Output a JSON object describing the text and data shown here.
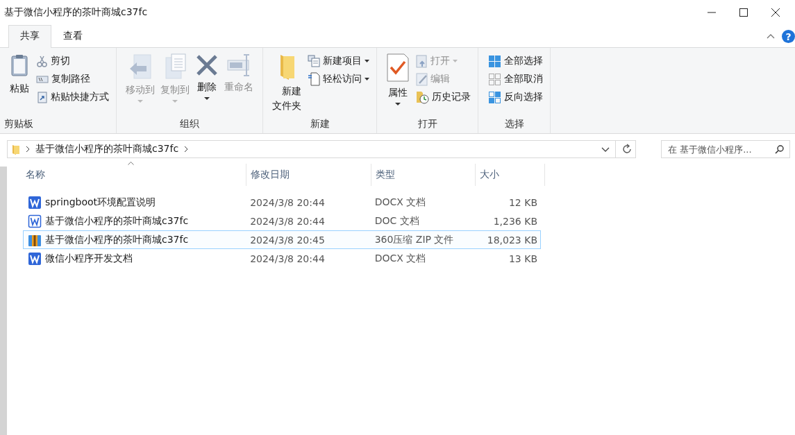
{
  "window": {
    "title": "基于微信小程序的茶叶商城c37fc"
  },
  "tabs": [
    {
      "label": "共享",
      "selected": true
    },
    {
      "label": "查看",
      "selected": false
    }
  ],
  "help": {
    "label": "?"
  },
  "ribbon": {
    "groups": [
      {
        "label": "剪贴板",
        "large": [
          {
            "kind": "paste",
            "label": "粘贴",
            "disabled": false,
            "dropdown": false
          }
        ],
        "small": [
          {
            "kind": "cut",
            "label": "剪切",
            "disabled": false,
            "dropdown": false
          },
          {
            "kind": "copy-path",
            "label": "复制路径",
            "disabled": false,
            "dropdown": false
          },
          {
            "kind": "paste-shortcut",
            "label": "粘贴快捷方式",
            "disabled": false,
            "dropdown": false
          }
        ]
      },
      {
        "label": "组织",
        "large": [
          {
            "kind": "move",
            "label": "移动到",
            "disabled": true,
            "dropdown": true
          },
          {
            "kind": "copy",
            "label": "复制到",
            "disabled": true,
            "dropdown": true
          },
          {
            "kind": "delete",
            "label": "删除",
            "disabled": false,
            "dropdown": true
          },
          {
            "kind": "rename",
            "label": "重命名",
            "disabled": true,
            "dropdown": false
          }
        ]
      },
      {
        "label": "新建",
        "large": [
          {
            "kind": "new-folder",
            "label": "新建文件夹",
            "disabled": false,
            "dropdown": false
          }
        ],
        "small": [
          {
            "kind": "new-item",
            "label": "新建项目",
            "disabled": false,
            "dropdown": true
          },
          {
            "kind": "easy-access",
            "label": "轻松访问",
            "disabled": false,
            "dropdown": true
          }
        ]
      },
      {
        "label": "打开",
        "large": [
          {
            "kind": "properties",
            "label": "属性",
            "disabled": false,
            "dropdown": true
          }
        ],
        "small": [
          {
            "kind": "open",
            "label": "打开",
            "disabled": true,
            "dropdown": true
          },
          {
            "kind": "edit",
            "label": "编辑",
            "disabled": true,
            "dropdown": false
          },
          {
            "kind": "history",
            "label": "历史记录",
            "disabled": false,
            "dropdown": false
          }
        ]
      },
      {
        "label": "选择",
        "small": [
          {
            "kind": "select-all",
            "label": "全部选择",
            "disabled": false,
            "dropdown": false
          },
          {
            "kind": "select-none",
            "label": "全部取消",
            "disabled": false,
            "dropdown": false
          },
          {
            "kind": "invert",
            "label": "反向选择",
            "disabled": false,
            "dropdown": false
          }
        ]
      }
    ]
  },
  "address_bar": {
    "path": "基于微信小程序的茶叶商城c37fc"
  },
  "search": {
    "placeholder": "在 基于微信小程序..."
  },
  "table": {
    "columns": [
      "名称",
      "修改日期",
      "类型",
      "大小"
    ],
    "rows": [
      {
        "kind": "docx",
        "name": "springboot环境配置说明",
        "date": "2024/3/8 20:44",
        "type": "DOCX 文档",
        "size": "12 KB",
        "selected": false
      },
      {
        "kind": "doc",
        "name": "基于微信小程序的茶叶商城c37fc",
        "date": "2024/3/8 20:44",
        "type": "DOC 文档",
        "size": "1,236 KB",
        "selected": false
      },
      {
        "kind": "zip",
        "name": "基于微信小程序的茶叶商城c37fc",
        "date": "2024/3/8 20:45",
        "type": "360压缩 ZIP 文件",
        "size": "18,023 KB",
        "selected": true
      },
      {
        "kind": "docx",
        "name": "微信小程序开发文档",
        "date": "2024/3/8 20:44",
        "type": "DOCX 文档",
        "size": "13 KB",
        "selected": false
      }
    ]
  }
}
